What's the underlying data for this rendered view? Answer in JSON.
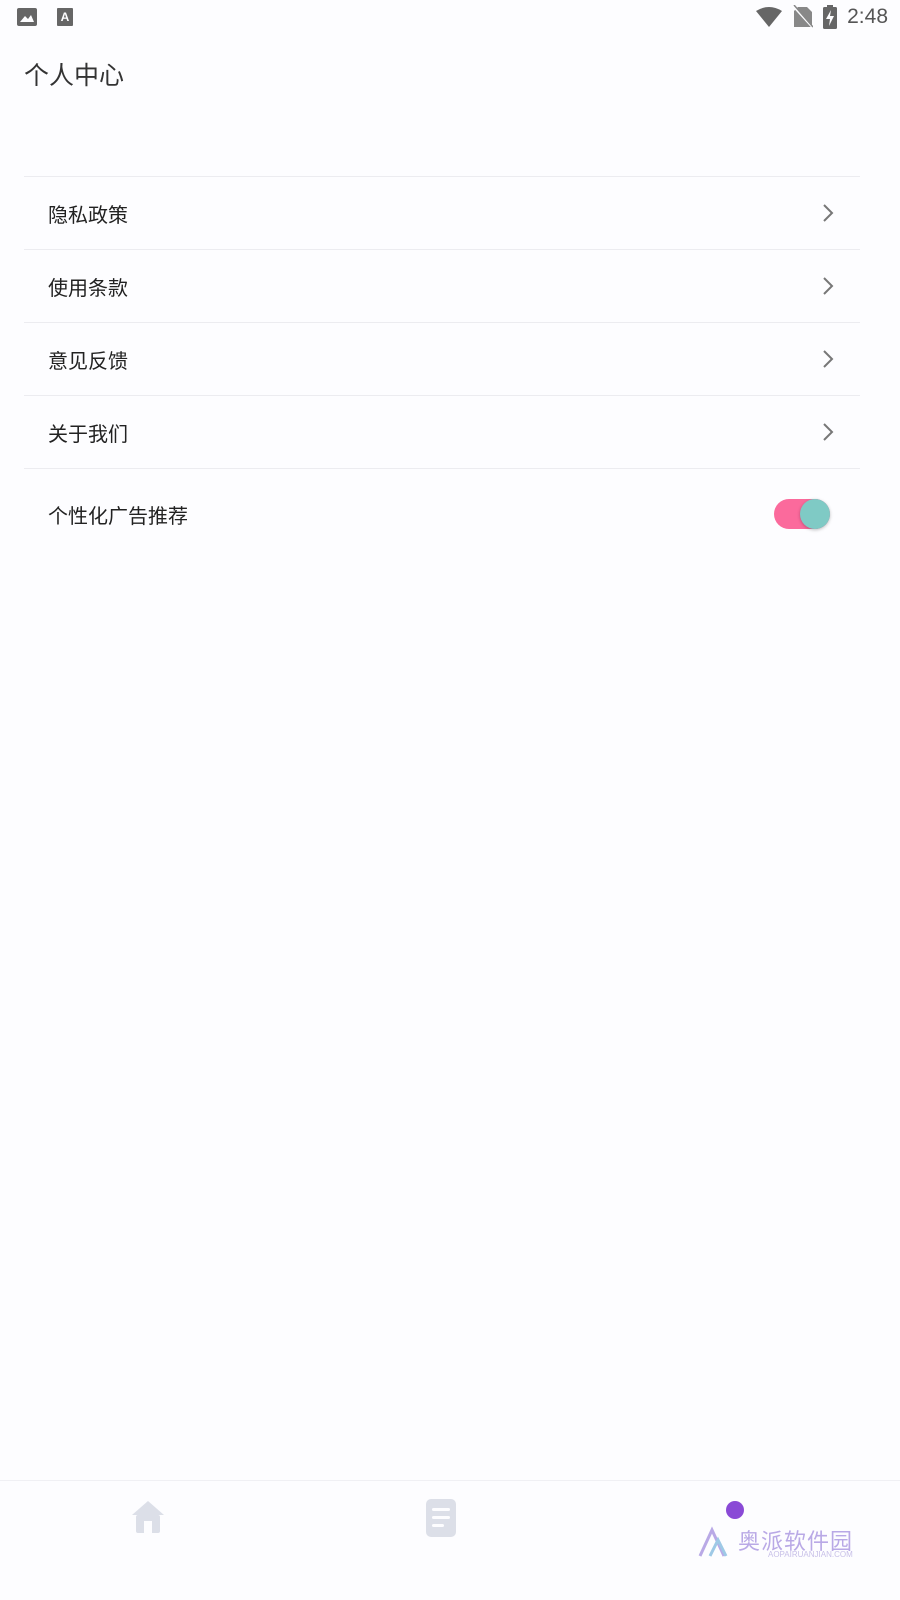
{
  "status_bar": {
    "time": "2:48",
    "left_icons": [
      "image-icon",
      "font-a-icon"
    ],
    "right_icons": [
      "wifi-icon",
      "no-sim-icon",
      "battery-charging-icon"
    ]
  },
  "header": {
    "title": "个人中心"
  },
  "menu": {
    "items": [
      {
        "label": "隐私政策",
        "icon": "chevron-right-icon"
      },
      {
        "label": "使用条款",
        "icon": "chevron-right-icon"
      },
      {
        "label": "意见反馈",
        "icon": "chevron-right-icon"
      },
      {
        "label": "关于我们",
        "icon": "chevron-right-icon"
      }
    ],
    "toggle": {
      "label": "个性化广告推荐",
      "on": true,
      "track_color": "#fb6a9c",
      "knob_color": "#7fcac5"
    }
  },
  "bottom_nav": {
    "items": [
      {
        "icon": "home-icon",
        "active": false
      },
      {
        "icon": "list-icon",
        "active": false
      },
      {
        "icon": "profile-dot-icon",
        "active": true,
        "color": "#8a4ad6"
      }
    ]
  },
  "watermark": {
    "text": "奥派软件园",
    "sub": "AOPAIRUANJIAN.COM"
  }
}
